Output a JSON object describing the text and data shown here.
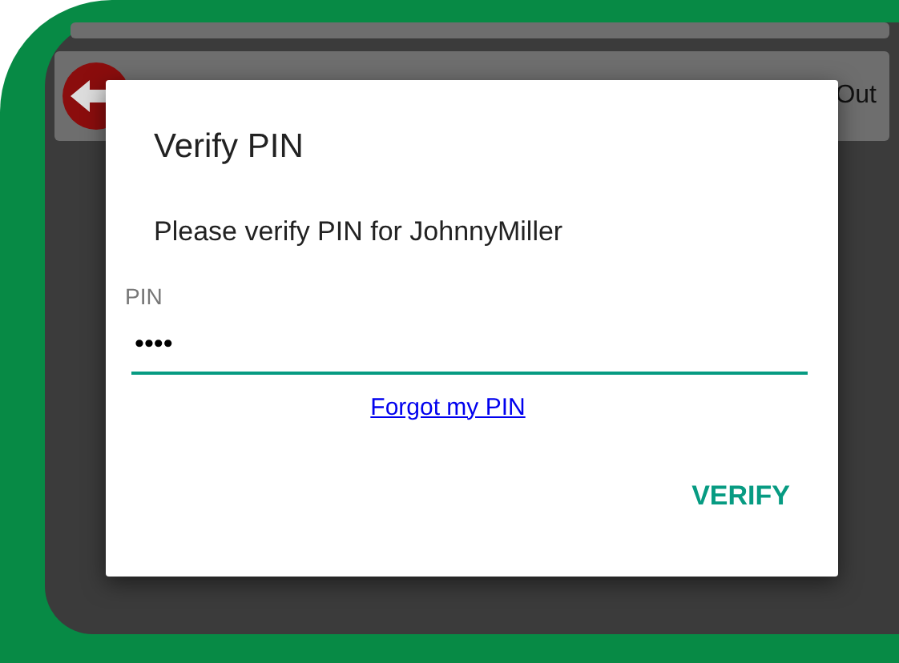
{
  "background": {
    "menu_items": [
      {
        "kind": "blank"
      },
      {
        "kind": "labeled",
        "label": "Out"
      }
    ]
  },
  "dialog": {
    "title": "Verify PIN",
    "message": "Please verify PIN for JohnnyMiller",
    "field": {
      "label": "PIN",
      "value": "••••",
      "focused": true
    },
    "link": "Forgot my PIN",
    "button": "VERIFY"
  }
}
